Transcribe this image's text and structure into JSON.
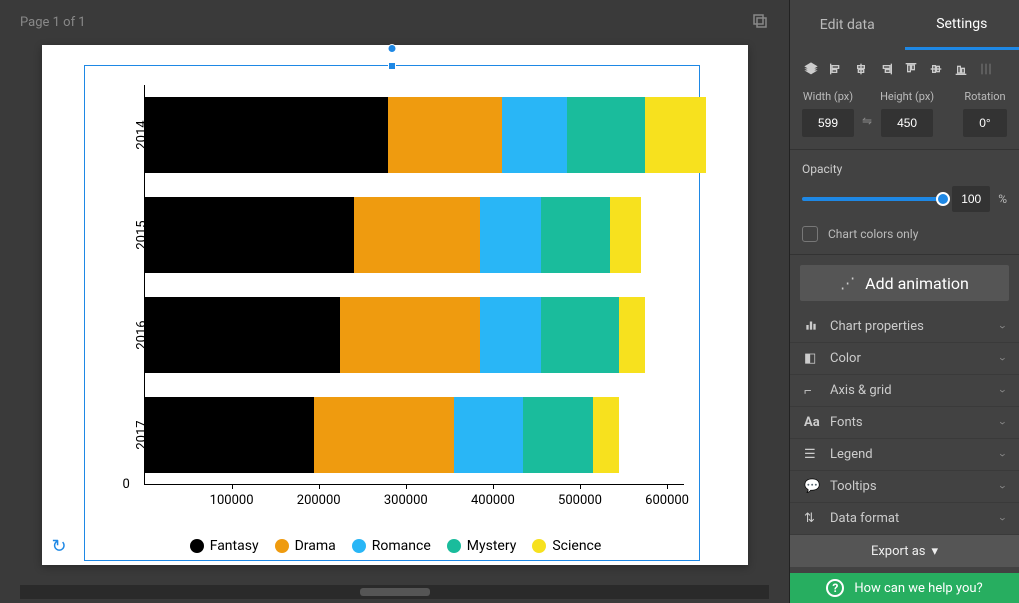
{
  "page_label": "Page 1 of 1",
  "tabs": {
    "edit_data": "Edit data",
    "settings": "Settings"
  },
  "dims": {
    "width_label": "Width (px)",
    "height_label": "Height (px)",
    "rotation_label": "Rotation",
    "width": "599",
    "height": "450",
    "rotation": "0°"
  },
  "opacity": {
    "label": "Opacity",
    "value": "100",
    "suffix": "%"
  },
  "chart_colors_only": "Chart colors only",
  "add_animation": "Add animation",
  "accordion": {
    "chart_properties": "Chart properties",
    "color": "Color",
    "axis_grid": "Axis & grid",
    "fonts": "Fonts",
    "legend": "Legend",
    "tooltips": "Tooltips",
    "data_format": "Data format"
  },
  "export_as": "Export as",
  "help": "How can we help you?",
  "chart_data": {
    "type": "bar",
    "orientation": "horizontal",
    "stacked": true,
    "categories": [
      "2014",
      "2015",
      "2016",
      "2017"
    ],
    "series": [
      {
        "name": "Fantasy",
        "color": "#000000",
        "values": [
          280000,
          240000,
          225000,
          195000
        ]
      },
      {
        "name": "Drama",
        "color": "#ef9b0f",
        "values": [
          130000,
          145000,
          160000,
          160000
        ]
      },
      {
        "name": "Romance",
        "color": "#29b6f6",
        "values": [
          75000,
          70000,
          70000,
          80000
        ]
      },
      {
        "name": "Mystery",
        "color": "#1abc9c",
        "values": [
          90000,
          80000,
          90000,
          80000
        ]
      },
      {
        "name": "Science",
        "color": "#f7e11e",
        "values": [
          70000,
          35000,
          30000,
          30000
        ]
      }
    ],
    "x_ticks": [
      100000,
      200000,
      300000,
      400000,
      500000,
      600000
    ],
    "x_range": [
      0,
      620000
    ],
    "xlabel": "",
    "ylabel": ""
  }
}
